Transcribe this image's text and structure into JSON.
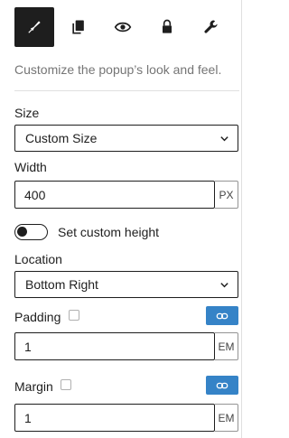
{
  "tabs": [
    {
      "icon": "brush-icon",
      "active": true
    },
    {
      "icon": "copy-icon",
      "active": false
    },
    {
      "icon": "eye-icon",
      "active": false
    },
    {
      "icon": "lock-icon",
      "active": false
    },
    {
      "icon": "wrench-icon",
      "active": false
    }
  ],
  "description": "Customize the popup’s look and feel.",
  "size": {
    "label": "Size",
    "value": "Custom Size"
  },
  "width": {
    "label": "Width",
    "value": "400",
    "unit": "PX"
  },
  "custom_height": {
    "label": "Set custom height",
    "enabled": false
  },
  "location": {
    "label": "Location",
    "value": "Bottom Right"
  },
  "padding": {
    "label": "Padding",
    "value": "1",
    "unit": "EM"
  },
  "margin": {
    "label": "Margin",
    "value": "1",
    "unit": "EM"
  },
  "colors": {
    "accent": "#3583c7",
    "text": "#1e1e1e",
    "muted": "#757575"
  }
}
